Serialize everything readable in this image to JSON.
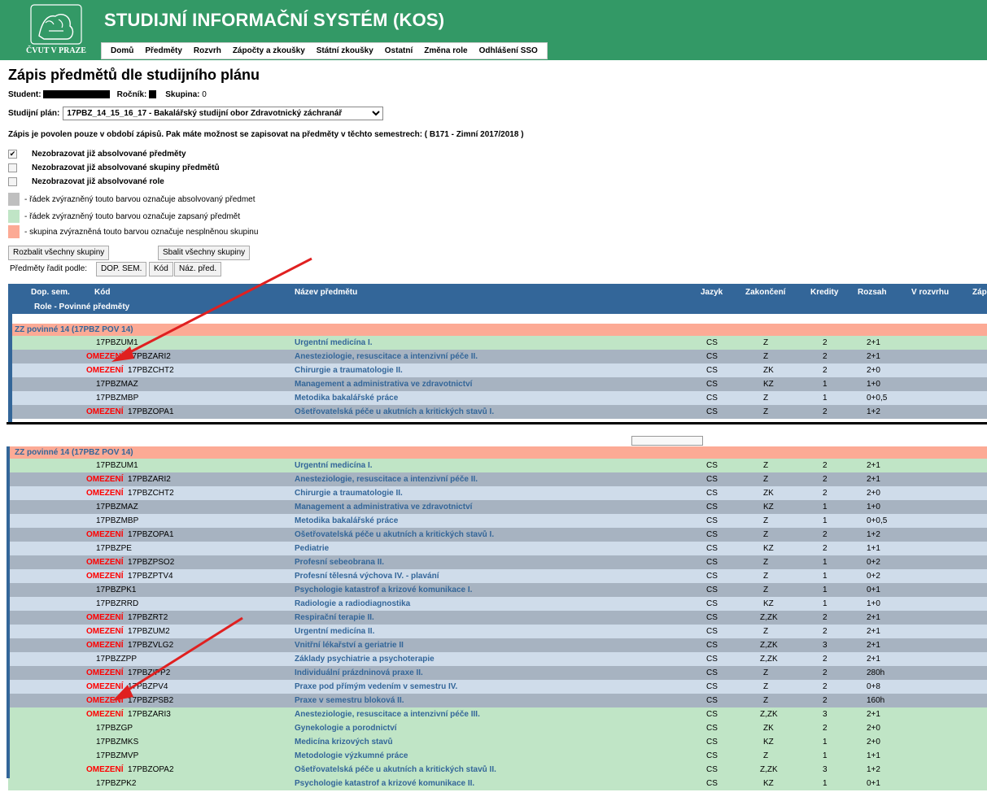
{
  "header": {
    "logo_text": "ČVUT V PRAZE",
    "system_title": "STUDIJNÍ INFORMAČNÍ SYSTÉM (KOS)",
    "menu": [
      "Domů",
      "Předměty",
      "Rozvrh",
      "Zápočty a zkoušky",
      "Státní zkoušky",
      "Ostatní",
      "Změna role",
      "Odhlášení SSO"
    ]
  },
  "page_title": "Zápis předmětů dle studijního plánu",
  "student_label": "Student:",
  "year_label": "Ročník:",
  "group_label": "Skupina:",
  "group_value": "0",
  "plan_label": "Studijní plán:",
  "plan_value": "17PBZ_14_15_16_17 - Bakalářský studijní obor Zdravotnický záchranář",
  "notice": "Zápis je povolen pouze v období zápisů. Pak máte možnost se zapisovat na předměty v těchto semestrech: ( B171 - Zimní 2017/2018 )",
  "options": [
    {
      "label": "Nezobrazovat již absolvované předměty",
      "checked": true
    },
    {
      "label": "Nezobrazovat již absolvované skupiny předmětů",
      "checked": false
    },
    {
      "label": "Nezobrazovat již absolvované role",
      "checked": false
    }
  ],
  "legend": [
    {
      "color": "#bfbfbf",
      "text": "- řádek zvýrazněný touto barvou označuje absolvovaný předmet"
    },
    {
      "color": "#c0e5c6",
      "text": "- řádek zvýrazněný touto barvou označuje zapsaný předmět"
    },
    {
      "color": "#fcaa95",
      "text": "- skupina zvýrazněná touto barvou označuje nesplněnou skupinu"
    }
  ],
  "buttons": {
    "expand": "Rozbalit všechny skupiny",
    "collapse": "Sbalit všechny skupiny"
  },
  "sort": {
    "label": "Předměty řadit podle:",
    "options": [
      "DOP. SEM.",
      "Kód",
      "Náz. před."
    ]
  },
  "columns": [
    "Dop. sem.",
    "Kód",
    "Název předmětu",
    "Jazyk",
    "Zakončení",
    "Kredity",
    "Rozsah",
    "V rozvrhu",
    "Záp"
  ],
  "role_title": "Role - Povinné předměty",
  "group_title": "ZZ povinné 14 (17PBZ POV 14)",
  "omezeni": "OMEZENÍ",
  "courses": [
    {
      "om": false,
      "code": "17PBZUM1",
      "name": "Urgentní medicína I.",
      "lang": "CS",
      "end": "Z",
      "cr": "2",
      "range": "2+1",
      "st": "green"
    },
    {
      "om": true,
      "code": "17PBZARI2",
      "name": "Anesteziologie, resuscitace a intenzivní péče II.",
      "lang": "CS",
      "end": "Z",
      "cr": "2",
      "range": "2+1",
      "st": "gray"
    },
    {
      "om": true,
      "code": "17PBZCHT2",
      "name": "Chirurgie a traumatologie II.",
      "lang": "CS",
      "end": "ZK",
      "cr": "2",
      "range": "2+0",
      "st": "light"
    },
    {
      "om": false,
      "code": "17PBZMAZ",
      "name": "Management a administrativa ve zdravotnictví",
      "lang": "CS",
      "end": "KZ",
      "cr": "1",
      "range": "1+0",
      "st": "gray"
    },
    {
      "om": false,
      "code": "17PBZMBP",
      "name": "Metodika bakalářské práce",
      "lang": "CS",
      "end": "Z",
      "cr": "1",
      "range": "0+0,5",
      "st": "light"
    },
    {
      "om": true,
      "code": "17PBZOPA1",
      "name": "Ošetřovatelská péče u akutních a kritických stavů I.",
      "lang": "CS",
      "end": "Z",
      "cr": "2",
      "range": "1+2",
      "st": "gray"
    },
    {
      "om": false,
      "code": "17PBZPE",
      "name": "Pediatrie",
      "lang": "CS",
      "end": "KZ",
      "cr": "2",
      "range": "1+1",
      "st": "light"
    },
    {
      "om": true,
      "code": "17PBZPSO2",
      "name": "Profesní sebeobrana II.",
      "lang": "CS",
      "end": "Z",
      "cr": "1",
      "range": "0+2",
      "st": "gray"
    },
    {
      "om": true,
      "code": "17PBZPTV4",
      "name": "Profesní tělesná výchova IV. - plavání",
      "lang": "CS",
      "end": "Z",
      "cr": "1",
      "range": "0+2",
      "st": "light"
    },
    {
      "om": false,
      "code": "17PBZPK1",
      "name": "Psychologie katastrof a krizové komunikace I.",
      "lang": "CS",
      "end": "Z",
      "cr": "1",
      "range": "0+1",
      "st": "gray"
    },
    {
      "om": false,
      "code": "17PBZRRD",
      "name": "Radiologie a radiodiagnostika",
      "lang": "CS",
      "end": "KZ",
      "cr": "1",
      "range": "1+0",
      "st": "light"
    },
    {
      "om": true,
      "code": "17PBZRT2",
      "name": "Respirační terapie II.",
      "lang": "CS",
      "end": "Z,ZK",
      "cr": "2",
      "range": "2+1",
      "st": "gray"
    },
    {
      "om": true,
      "code": "17PBZUM2",
      "name": "Urgentní medicína II.",
      "lang": "CS",
      "end": "Z",
      "cr": "2",
      "range": "2+1",
      "st": "light"
    },
    {
      "om": true,
      "code": "17PBZVLG2",
      "name": "Vnitřní lékařství a geriatrie II",
      "lang": "CS",
      "end": "Z,ZK",
      "cr": "3",
      "range": "2+1",
      "st": "gray"
    },
    {
      "om": false,
      "code": "17PBZZPP",
      "name": "Základy psychiatrie a psychoterapie",
      "lang": "CS",
      "end": "Z,ZK",
      "cr": "2",
      "range": "2+1",
      "st": "light"
    },
    {
      "om": true,
      "code": "17PBZIPP2",
      "name": "Individuální prázdninová praxe II.",
      "lang": "CS",
      "end": "Z",
      "cr": "2",
      "range": "280h",
      "st": "gray"
    },
    {
      "om": true,
      "code": "17PBZPV4",
      "name": "Praxe pod přímým vedením v semestru IV.",
      "lang": "CS",
      "end": "Z",
      "cr": "2",
      "range": "0+8",
      "st": "light"
    },
    {
      "om": true,
      "code": "17PBZPSB2",
      "name": "Praxe v semestru bloková II.",
      "lang": "CS",
      "end": "Z",
      "cr": "2",
      "range": "160h",
      "st": "gray"
    },
    {
      "om": true,
      "code": "17PBZARI3",
      "name": "Anesteziologie, resuscitace a intenzivní péče III.",
      "lang": "CS",
      "end": "Z,ZK",
      "cr": "3",
      "range": "2+1",
      "st": "green"
    },
    {
      "om": false,
      "code": "17PBZGP",
      "name": "Gynekologie a porodnictví",
      "lang": "CS",
      "end": "ZK",
      "cr": "2",
      "range": "2+0",
      "st": "green"
    },
    {
      "om": false,
      "code": "17PBZMKS",
      "name": "Medicína krizových stavů",
      "lang": "CS",
      "end": "KZ",
      "cr": "1",
      "range": "2+0",
      "st": "green"
    },
    {
      "om": false,
      "code": "17PBZMVP",
      "name": "Metodologie výzkumné práce",
      "lang": "CS",
      "end": "Z",
      "cr": "1",
      "range": "1+1",
      "st": "green"
    },
    {
      "om": true,
      "code": "17PBZOPA2",
      "name": "Ošetřovatelská péče u akutních a kritických stavů II.",
      "lang": "CS",
      "end": "Z,ZK",
      "cr": "3",
      "range": "1+2",
      "st": "green"
    },
    {
      "om": false,
      "code": "17PBZPK2",
      "name": "Psychologie katastrof a krizové komunikace II.",
      "lang": "CS",
      "end": "KZ",
      "cr": "1",
      "range": "0+1",
      "st": "green"
    }
  ],
  "colors": {
    "header_green": "#339966",
    "table_blue": "#336699",
    "arrow_red": "#e02020"
  }
}
